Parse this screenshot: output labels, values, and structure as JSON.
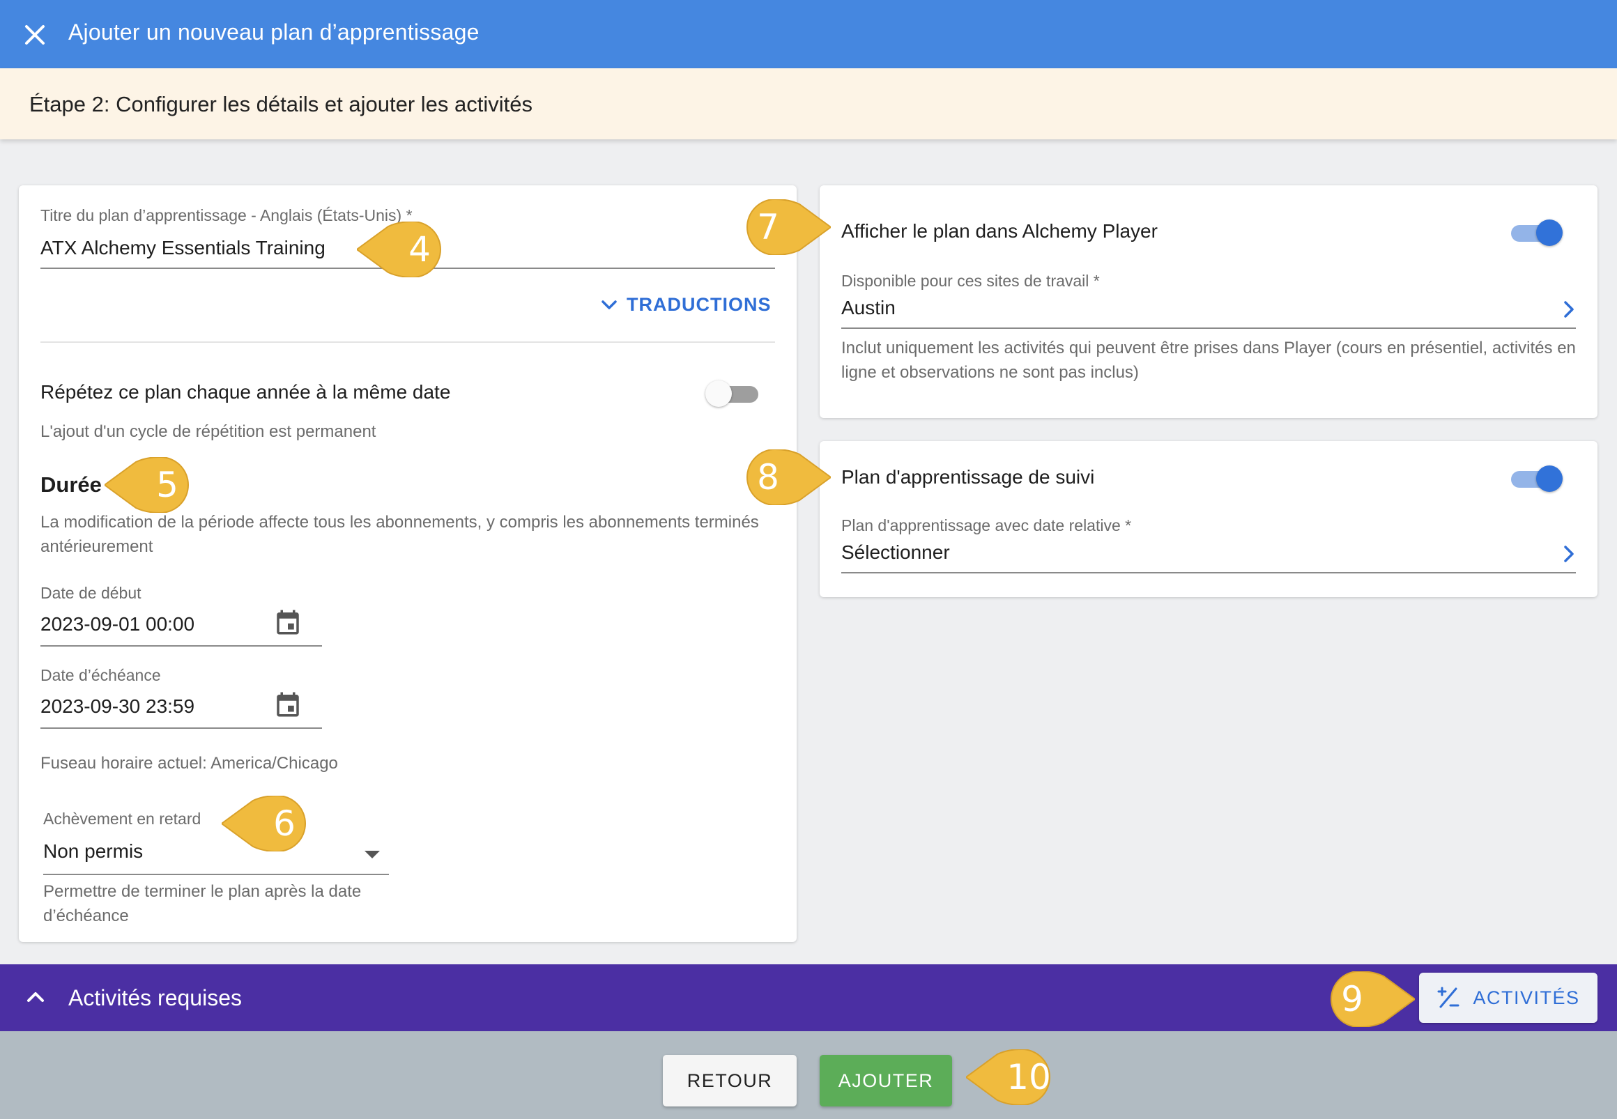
{
  "header": {
    "title": "Ajouter un nouveau plan d’apprentissage",
    "close_icon": "close-icon"
  },
  "step": {
    "title": "Étape 2: Configurer les détails et ajouter les activités"
  },
  "left_card": {
    "title_field": {
      "label": "Titre du plan d’apprentissage - Anglais (États-Unis) *",
      "value": "ATX Alchemy Essentials Training"
    },
    "translations_label": "TRADUCTIONS",
    "repeat": {
      "label": "Répétez ce plan chaque année à la même date",
      "enabled": false,
      "helper": "L'ajout d'un cycle de répétition est permanent"
    },
    "duration": {
      "heading": "Durée",
      "helper": "La modification de la période affecte tous les abonnements, y compris les abonnements terminés antérieurement"
    },
    "start_date": {
      "label": "Date de début",
      "value": "2023-09-01 00:00"
    },
    "due_date": {
      "label": "Date d’échéance",
      "value": "2023-09-30 23:59"
    },
    "timezone": "Fuseau horaire actuel: America/Chicago",
    "late_completion": {
      "label": "Achèvement en retard",
      "value": "Non permis",
      "helper": "Permettre de terminer le plan après la date d’échéance"
    }
  },
  "player_card": {
    "title": "Afficher le plan dans Alchemy Player",
    "enabled": true,
    "sites_label": "Disponible pour ces sites de travail *",
    "sites_value": "Austin",
    "helper": "Inclut uniquement les activités qui peuvent être prises dans Player (cours en présentiel, activités en ligne et observations ne sont pas inclus)"
  },
  "followup_card": {
    "title": "Plan d'apprentissage de suivi",
    "enabled": true,
    "relative_label": "Plan d'apprentissage avec date relative *",
    "relative_value": "Sélectionner"
  },
  "required_activities": {
    "title": "Activités requises",
    "button_label": "ACTIVITÉS"
  },
  "footer": {
    "back_label": "RETOUR",
    "add_label": "AJOUTER"
  },
  "callouts": [
    "4",
    "5",
    "6",
    "7",
    "8",
    "9",
    "10"
  ],
  "colors": {
    "header": "#4587e0",
    "banner": "#fdf4e6",
    "purple_bar": "#4b2fa3",
    "accent": "#2f6ed6",
    "add_button": "#5cad58",
    "callout": "#f0bb3e"
  }
}
